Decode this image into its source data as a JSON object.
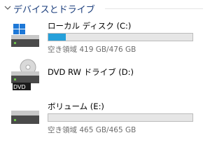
{
  "section": {
    "title": "デバイスとドライブ"
  },
  "drives": [
    {
      "name": "ローカル ディスク (C:)",
      "free_text": "空き領域 419 GB/476 GB",
      "used_fraction": 0.12,
      "icon": "windows-drive-icon"
    },
    {
      "name": "DVD RW ドライブ (D:)",
      "badge": "DVD",
      "icon": "dvd-drive-icon"
    },
    {
      "name": "ボリューム (E:)",
      "free_text": "空き領域 465 GB/465 GB",
      "used_fraction": 0.0,
      "icon": "hard-drive-icon"
    }
  ],
  "colors": {
    "section_title": "#1a3d7c",
    "bar_fill": "#26a0da",
    "bar_track": "#e6e6e6",
    "free_text": "#6d6d6d"
  }
}
